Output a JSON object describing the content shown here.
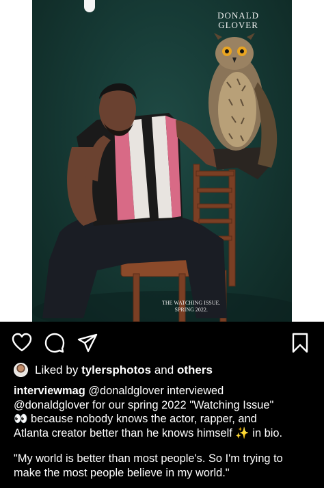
{
  "photo": {
    "magazine_name": "DONALD\nGLOVER",
    "cover_caption": "THE WATCHING ISSUE.\nSPRING 2022."
  },
  "actions": {
    "like_icon": "heart-icon",
    "comment_icon": "comment-icon",
    "share_icon": "send-icon",
    "save_icon": "bookmark-icon"
  },
  "likes": {
    "prefix": "Liked by",
    "user": "tylersphotos",
    "and": "and",
    "others": "others"
  },
  "caption": {
    "username": "interviewmag",
    "line1_rest": "@donaldglover interviewed",
    "line2": "@donaldglover for our spring 2022 \"Watching Issue\"",
    "line3": "👀 because nobody knows the actor, rapper, and",
    "line4": "Atlanta creator better than he knows himself ✨  in bio.",
    "quote_line1": "\"My world is better than most people's. So I'm trying to",
    "quote_line2": "make the most people believe in my world.\""
  }
}
